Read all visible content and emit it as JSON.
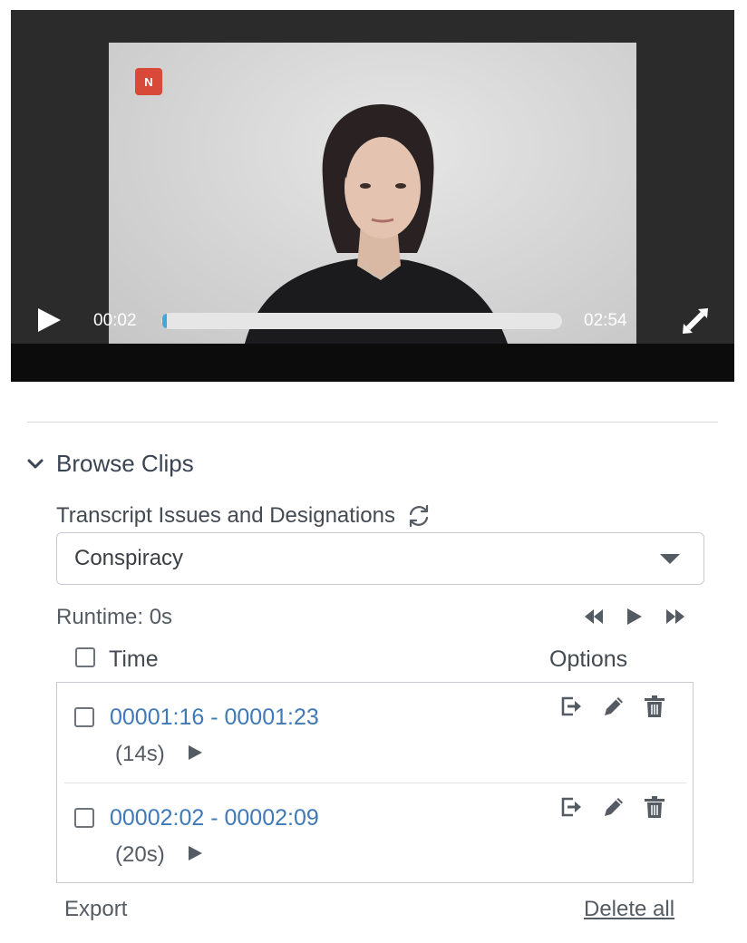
{
  "player": {
    "logo_text": "N",
    "current_time": "00:02",
    "duration": "02:54",
    "progress_fraction": 0.011,
    "accent_color": "#3fa7dd"
  },
  "browse": {
    "title": "Browse Clips",
    "section_label": "Transcript Issues and Designations",
    "selected_option": "Conspiracy",
    "runtime": "Runtime: 0s",
    "columns": {
      "time": "Time",
      "options": "Options"
    },
    "clips": [
      {
        "range": "00001:16 - 00001:23",
        "duration": "(14s)"
      },
      {
        "range": "00002:02 - 00002:09",
        "duration": "(20s)"
      }
    ],
    "link_color": "#3f79b7",
    "export_label": "Export",
    "delete_all_label": "Delete all"
  },
  "icons": {
    "play": "play-icon",
    "fullscreen": "fullscreen-icon",
    "collapse": "chevron-down-icon",
    "refresh": "refresh-icon",
    "dropdown": "caret-down-icon",
    "rewind": "rewind-icon",
    "forward": "fast-forward-icon",
    "export": "export-icon",
    "edit": "pencil-icon",
    "delete": "trash-icon"
  }
}
